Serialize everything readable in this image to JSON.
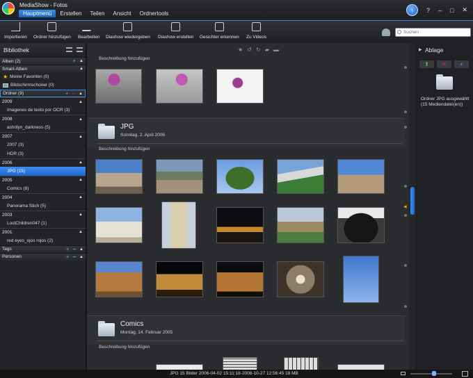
{
  "app": {
    "title": "MediaShow - Fotos"
  },
  "menu": [
    {
      "label": "Hauptmenü",
      "active": true
    },
    {
      "label": "Erstellen"
    },
    {
      "label": "Teilen"
    },
    {
      "label": "Ansicht"
    },
    {
      "label": "Ordnertools"
    }
  ],
  "window_controls": {
    "help": "?",
    "minimize": "–",
    "restore": "□",
    "close": "✕"
  },
  "toolbar": {
    "import": "Importieren",
    "add_folder": "Ordner hinzufügen",
    "edit": "Bearbeiten",
    "play_slideshow": "Diashow wiedergeben",
    "create_slideshow": "Diashow erstellen",
    "recognize_faces": "Gesichter erkennen",
    "to_videos": "Zu Videos",
    "search_placeholder": "Suchen"
  },
  "library": {
    "title": "Bibliothek",
    "albums": "Alben (2)",
    "smart_albums": "Smart-Alben",
    "favorites": "Meine Favoriten (0)",
    "screensaver": "Bildschirmschoner (0)",
    "folders": "Ordner (9)",
    "y2009": "2009",
    "f2009": "imagenes de texto por OCR (3)",
    "y2008": "2008",
    "f2008": "ashrilyn_darkness (5)",
    "y2007": "2007",
    "f2007a": "2007 (3)",
    "f2007b": "HDR (3)",
    "y2006": "2006",
    "f2006": "JPG (15)",
    "y2005": "2005",
    "f2005": "Comics (8)",
    "y2004": "2004",
    "f2004": "Panorama Stich (5)",
    "y2003": "2003",
    "f2003": "LostChildren047 (1)",
    "y2001": "2001",
    "f2001": "red eyes_ojos rojos (2)",
    "tags": "Tags",
    "people": "Personen"
  },
  "center": {
    "add_description": "Beschreibung hinzufügen",
    "group_jpg": {
      "name": "JPG",
      "date": "Sonntag, 2. April 2006"
    },
    "group_comics": {
      "name": "Comics",
      "date": "Montag, 14. Februar 2005"
    }
  },
  "tray": {
    "title": "Ablage",
    "info": "Ordner JPG ausgewählt (15 Mediendatei(en))"
  },
  "status": {
    "text": "JPG  15 Bilder  2006-04-02 15:11:18-2006-10-27 12:56:45  18 MB"
  },
  "colors": {
    "accent": "#2a78dc",
    "scroll_marker": "#f2a31a"
  }
}
